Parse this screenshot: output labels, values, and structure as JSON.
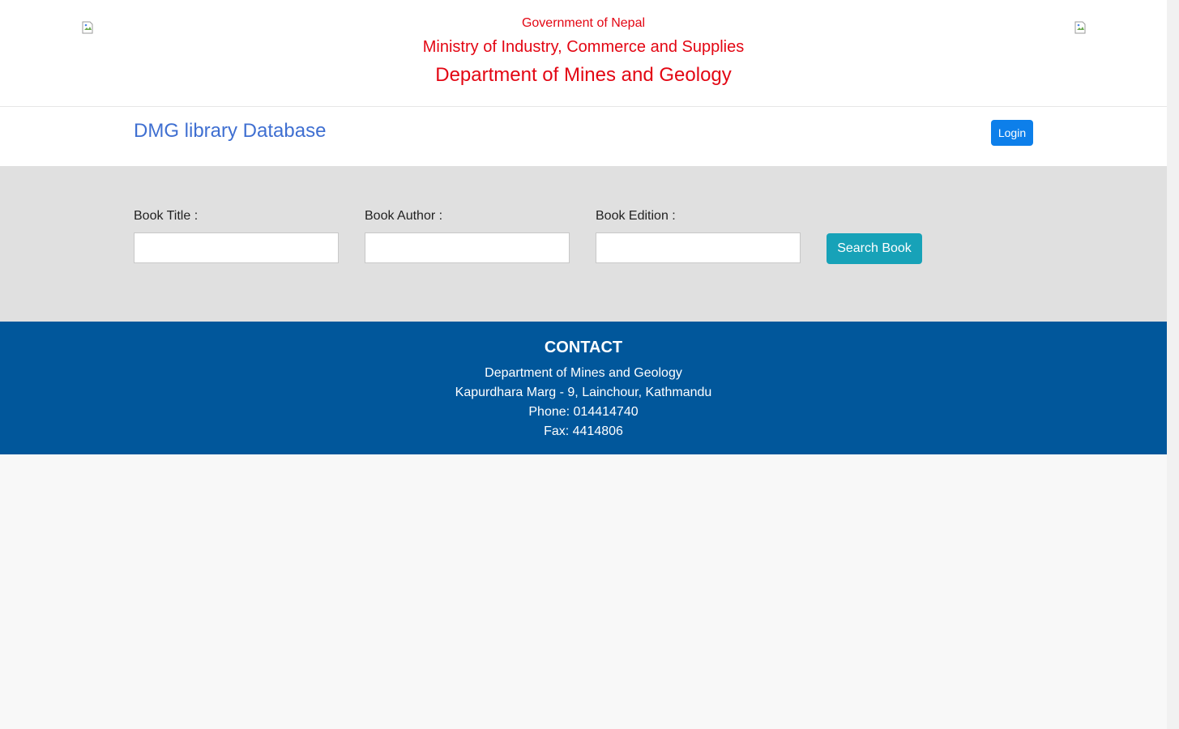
{
  "header": {
    "government": "Government of Nepal",
    "ministry": "Ministry of Industry, Commerce and Supplies",
    "department": "Department of Mines and Geology",
    "left_logo_icon": "broken-image-icon",
    "right_logo_icon": "broken-image-icon"
  },
  "navbar": {
    "brand": "DMG library Database",
    "login_label": "Login"
  },
  "search": {
    "title_label": "Book Title :",
    "title_value": "",
    "author_label": "Book Author :",
    "author_value": "",
    "edition_label": "Book Edition :",
    "edition_value": "",
    "button_label": "Search Book"
  },
  "contact": {
    "title": "CONTACT",
    "lines": [
      "Department of Mines and Geology",
      "Kapurdhara Marg - 9, Lainchour, Kathmandu",
      "Phone: 014414740",
      "Fax: 4414806"
    ]
  },
  "colors": {
    "header_text": "#e30613",
    "brand": "#3f6fd1",
    "login_button": "#0d7fea",
    "search_button": "#17a2b8",
    "footer_bg": "#01579b",
    "search_bg": "#e0e0e0"
  }
}
